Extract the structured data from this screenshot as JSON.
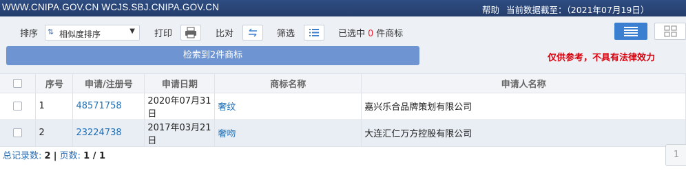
{
  "topbar": {
    "site": "WWW.CNIPA.GOV.CN WCJS.SBJ.CNIPA.GOV.CN",
    "help": "帮助",
    "as_of": "当前数据截至：（2021年07月19日）"
  },
  "toolbar": {
    "sort_label": "排序",
    "sort_value": "相似度排序",
    "print_label": "打印",
    "compare_label": "比对",
    "filter_label": "筛选",
    "selected_prefix": "已选中",
    "selected_count": "0",
    "selected_suffix": "件商标",
    "search_result": "检索到2件商标",
    "disclaimer": "仅供参考，不具有法律效力"
  },
  "table": {
    "headers": [
      "",
      "序号",
      "申请/注册号",
      "申请日期",
      "商标名称",
      "申请人名称"
    ],
    "rows": [
      {
        "index": "1",
        "reg_no": "48571758",
        "date": "2020年07月31日",
        "mark": "奢纹",
        "applicant": "嘉兴乐合品牌策划有限公司"
      },
      {
        "index": "2",
        "reg_no": "23224738",
        "date": "2017年03月21日",
        "mark": "奢吻",
        "applicant": "大连汇仁万方控股有限公司"
      }
    ]
  },
  "summary": {
    "total_label": "总记录数:",
    "total": "2",
    "sep": "|",
    "pages_label": "页数:",
    "pages": "1 / 1"
  },
  "pager": {
    "page": "1"
  },
  "colors": {
    "header": "#2f4d82",
    "accent": "#3a7fd0",
    "search_bar": "#6e95d2",
    "disclaimer": "#d8000c",
    "link": "#1f6fb5"
  },
  "icons": {
    "sort": "sort-arrows-icon",
    "print": "printer-icon",
    "compare": "compare-arrows-icon",
    "filter": "list-filter-icon",
    "list_view": "list-view-icon",
    "grid_view": "grid-view-icon",
    "dropdown": "chevron-down-icon"
  }
}
